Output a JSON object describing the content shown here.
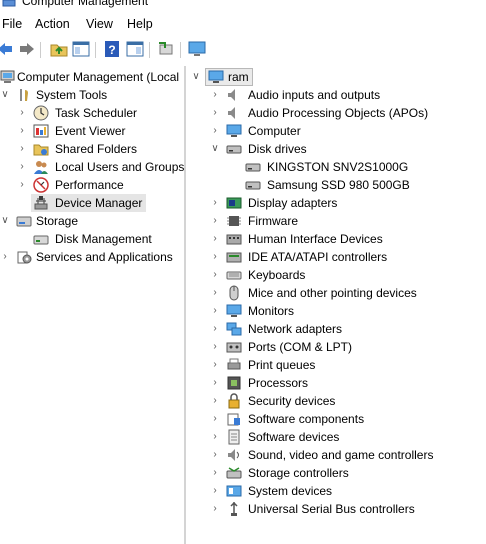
{
  "window": {
    "title": "Computer Management"
  },
  "menu": {
    "file": "File",
    "action": "Action",
    "view": "View",
    "help": "Help"
  },
  "tree": {
    "root": "Computer Management (Local",
    "system_tools": "System Tools",
    "task_scheduler": "Task Scheduler",
    "event_viewer": "Event Viewer",
    "shared_folders": "Shared Folders",
    "local_users": "Local Users and Groups",
    "performance": "Performance",
    "device_manager": "Device Manager",
    "storage": "Storage",
    "disk_management": "Disk Management",
    "services": "Services and Applications"
  },
  "devices": {
    "root": "ram",
    "categories": [
      "Audio inputs and outputs",
      "Audio Processing Objects (APOs)",
      "Computer",
      "Disk drives",
      "Display adapters",
      "Firmware",
      "Human Interface Devices",
      "IDE ATA/ATAPI controllers",
      "Keyboards",
      "Mice and other pointing devices",
      "Monitors",
      "Network adapters",
      "Ports (COM & LPT)",
      "Print queues",
      "Processors",
      "Security devices",
      "Software components",
      "Software devices",
      "Sound, video and game controllers",
      "Storage controllers",
      "System devices",
      "Universal Serial Bus controllers"
    ],
    "disk_children": [
      "KINGSTON SNV2S1000G",
      "Samsung SSD 980 500GB"
    ]
  }
}
